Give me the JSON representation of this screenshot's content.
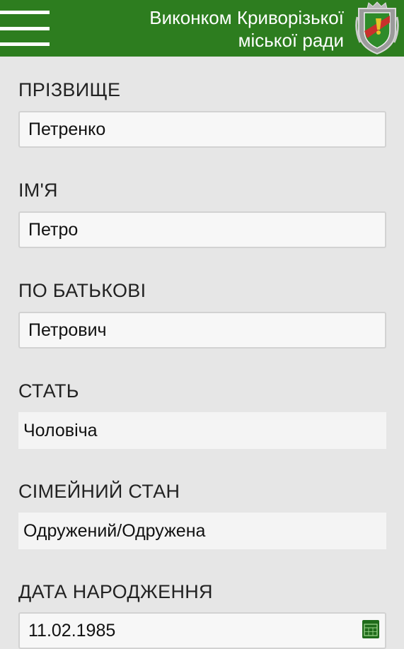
{
  "header": {
    "title_line1": "Виконком Криворізької",
    "title_line2": "міської ради",
    "menu_icon": "hamburger-menu-icon",
    "emblem_icon": "city-coat-of-arms",
    "background_color": "#2d7d1f"
  },
  "form": {
    "surname": {
      "label": "ПРІЗВИЩЕ",
      "value": "Петренко"
    },
    "first_name": {
      "label": "ІМ'Я",
      "value": "Петро"
    },
    "patronymic": {
      "label": "ПО БАТЬКОВІ",
      "value": "Петрович"
    },
    "sex": {
      "label": "СТАТЬ",
      "value": "Чоловіча"
    },
    "marital_status": {
      "label": "СІМЕЙНИЙ СТАН",
      "value": "Одружений/Одружена"
    },
    "birth_date": {
      "label": "ДАТА НАРОДЖЕННЯ",
      "value": "11.02.1985",
      "icon": "calendar-icon"
    }
  }
}
